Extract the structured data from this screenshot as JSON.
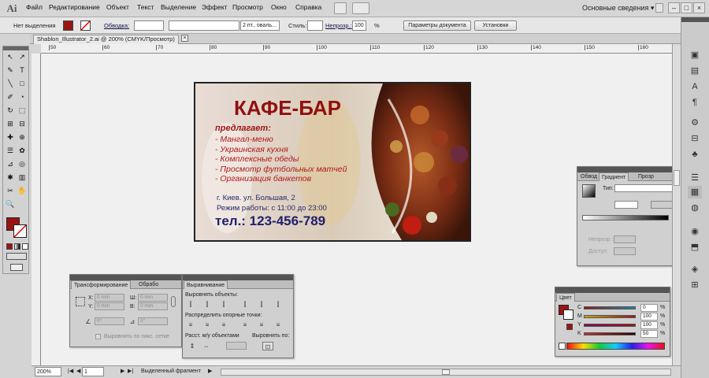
{
  "app": {
    "logo": "Ai"
  },
  "menu": [
    "Файл",
    "Редактирование",
    "Объект",
    "Текст",
    "Выделение",
    "Эффект",
    "Просмотр",
    "Окно",
    "Справка"
  ],
  "workspace": {
    "label": "Основные сведения",
    "arrow": "▾"
  },
  "window_buttons": {
    "minimize": "–",
    "maximize": "□",
    "close": "×"
  },
  "control": {
    "selection_label": "Нет выделения",
    "stroke_label": "Обводка:",
    "brush_value": "2 пт., оваль...",
    "style_label": "Стиль:",
    "opacity_label": "Непрозр.:",
    "opacity_value": "100",
    "percent": "%",
    "doc_settings": "Параметры документа",
    "prefs": "Установки",
    "fill_color": "#9b1414"
  },
  "tab": {
    "title": "Shablon_Illustrator_2.ai @ 200% (CMYK/Просмотр)",
    "close": "×"
  },
  "ruler": {
    "marks": [
      "50",
      "60",
      "70",
      "80",
      "90",
      "100",
      "110",
      "120",
      "130",
      "140",
      "150",
      "160"
    ]
  },
  "tools": [
    "↖",
    "↗",
    "✎",
    "T",
    "╲",
    "□",
    "✐",
    "◔",
    "↻",
    "⬚",
    "⊞",
    "⊟",
    "✚",
    "⊕",
    "☰",
    "✿",
    "⊿",
    "◎",
    "✱",
    "▥",
    "✂",
    "✋",
    "🔍",
    ""
  ],
  "card": {
    "title": "КАФЕ-БАР",
    "offers_heading": "предлагает:",
    "offers": [
      "- Мангал-меню",
      "- Украинская кухня",
      "- Комплексные обеды",
      "- Просмотр футбольных матчей",
      "- Организация банкетов"
    ],
    "address": "г. Киев. ул. Большая, 2",
    "hours": "Режим работы: с 11:00 до 23:00",
    "phone": "тел.: 123-456-789"
  },
  "gradient_panel": {
    "tabs": [
      "Обвод",
      "Градиент",
      "Прозр"
    ],
    "type_label": "Тип:",
    "opacity_label": "Непрозр.:",
    "location_label": "Доступ:"
  },
  "transform_panel": {
    "tabs": [
      "Трансформирование",
      "Обрабо"
    ],
    "x_label": "X:",
    "y_label": "Y:",
    "w_label": "Ш:",
    "h_label": "В:",
    "x": "0 mm",
    "y": "0 mm",
    "w": "0 mm",
    "h": "0 mm",
    "angle": "0°",
    "shear": "0°",
    "pixel_grid": "Выровнять по пикс. сетке"
  },
  "align_panel": {
    "title": "Выравнивание",
    "align_objects": "Выровнять объекты:",
    "distribute": "Распределить опорные точки:",
    "spacing": "Расст. м/у объектами",
    "align_to": "Выровнять по:"
  },
  "color_panel": {
    "title": "Цвет",
    "channels": [
      {
        "name": "C",
        "value": "0"
      },
      {
        "name": "M",
        "value": "100"
      },
      {
        "name": "Y",
        "value": "100"
      },
      {
        "name": "K",
        "value": "50"
      }
    ],
    "percent": "%"
  },
  "status": {
    "zoom": "200%",
    "page": "1",
    "mode": "Выделенный фрагмент"
  }
}
